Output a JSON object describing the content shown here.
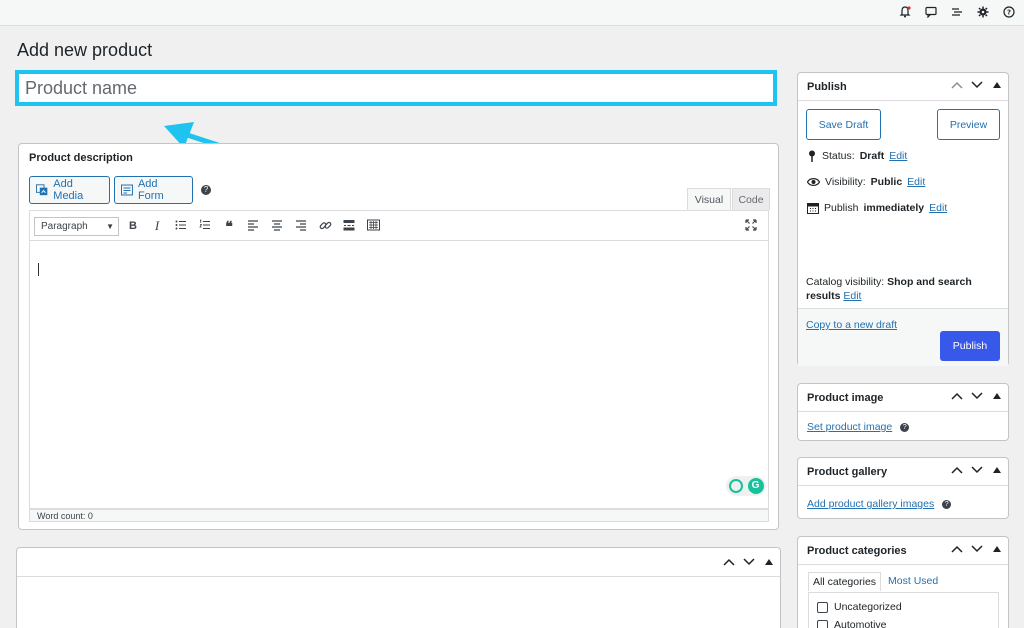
{
  "page": {
    "title": "Add new product"
  },
  "product_name": {
    "placeholder": "Product name"
  },
  "description": {
    "title": "Product description",
    "add_media": "Add Media",
    "add_form": "Add Form",
    "help": "?",
    "tabs": [
      "Visual",
      "Code"
    ],
    "format_select": "Paragraph",
    "word_count": "Word count: 0"
  },
  "publish": {
    "title": "Publish",
    "save_draft": "Save Draft",
    "preview": "Preview",
    "status_label": "Status:",
    "status_value": "Draft",
    "visibility_label": "Visibility:",
    "visibility_value": "Public",
    "publish_label": "Publish",
    "publish_value": "immediately",
    "edit": "Edit",
    "catalog_label": "Catalog visibility:",
    "catalog_value": "Shop and search results",
    "copy_draft": "Copy to a new draft",
    "publish_button": "Publish"
  },
  "product_image": {
    "title": "Product image",
    "link": "Set product image"
  },
  "product_gallery": {
    "title": "Product gallery",
    "link": "Add product gallery images"
  },
  "product_categories": {
    "title": "Product categories",
    "tabs": [
      "All categories",
      "Most Used"
    ],
    "items": [
      "Uncategorized",
      "Automotive"
    ]
  },
  "colors": {
    "accent": "#1ec3ef",
    "primary": "#3858e9",
    "link": "#2271b1"
  }
}
